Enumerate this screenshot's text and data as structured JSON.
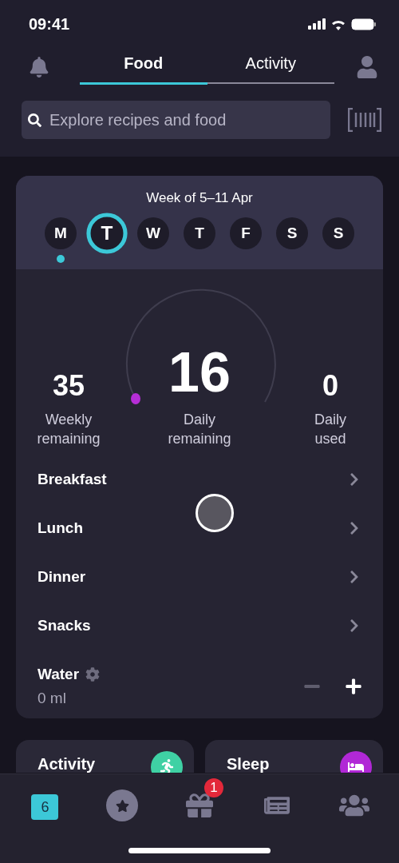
{
  "status_bar": {
    "time": "09:41"
  },
  "tabs": [
    {
      "label": "Food",
      "selected": true
    },
    {
      "label": "Activity",
      "selected": false
    }
  ],
  "search": {
    "placeholder": "Explore recipes and food"
  },
  "week": {
    "title": "Week of 5–11 Apr",
    "days": [
      {
        "letter": "M",
        "selected": false,
        "marked": true
      },
      {
        "letter": "T",
        "selected": true,
        "marked": false
      },
      {
        "letter": "W",
        "selected": false,
        "marked": false
      },
      {
        "letter": "T",
        "selected": false,
        "marked": false
      },
      {
        "letter": "F",
        "selected": false,
        "marked": false
      },
      {
        "letter": "S",
        "selected": false,
        "marked": false
      },
      {
        "letter": "S",
        "selected": false,
        "marked": false
      }
    ]
  },
  "stats": [
    {
      "value": "35",
      "label": "Weekly remaining"
    },
    {
      "value": "16",
      "label": "Daily remaining"
    },
    {
      "value": "0",
      "label": "Daily used"
    }
  ],
  "meals": [
    {
      "name": "Breakfast"
    },
    {
      "name": "Lunch"
    },
    {
      "name": "Dinner"
    },
    {
      "name": "Snacks"
    }
  ],
  "water": {
    "title": "Water",
    "amount": "0 ml"
  },
  "tiles": [
    {
      "title": "Activity",
      "color": "#3fd1a4"
    },
    {
      "title": "Sleep",
      "color": "#b128d6"
    }
  ],
  "nav": [
    {
      "selected": true,
      "label": "6"
    },
    {
      "selected": false
    },
    {
      "selected": false,
      "badge": "1"
    },
    {
      "selected": false
    },
    {
      "selected": false
    }
  ]
}
